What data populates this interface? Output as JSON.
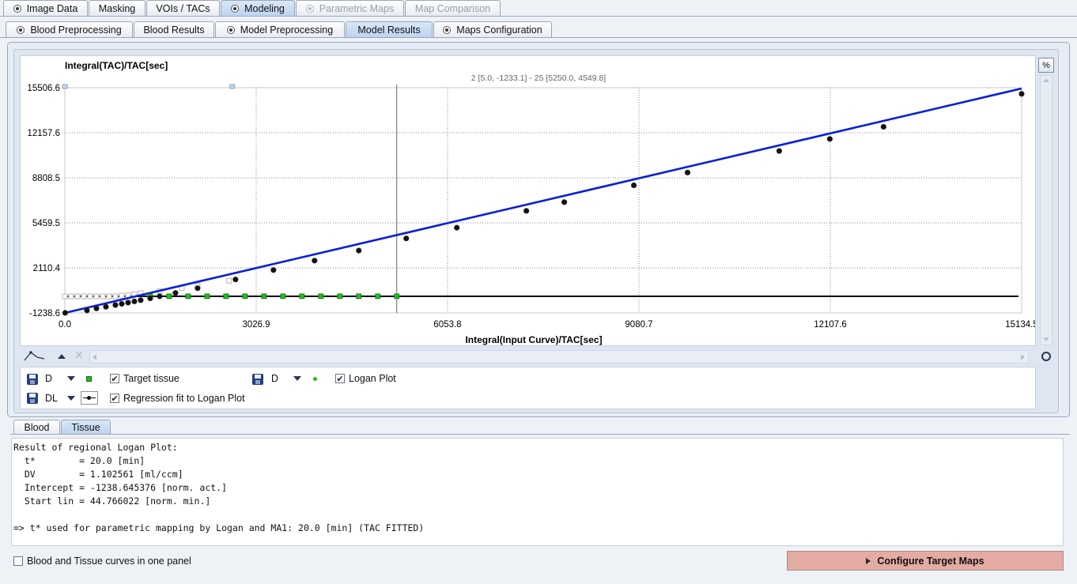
{
  "tabs_top": [
    {
      "label": "Image Data",
      "radio": true,
      "state": "normal"
    },
    {
      "label": "Masking",
      "radio": false,
      "state": "normal"
    },
    {
      "label": "VOIs / TACs",
      "radio": false,
      "state": "normal"
    },
    {
      "label": "Modeling",
      "radio": true,
      "state": "selected"
    },
    {
      "label": "Parametric Maps",
      "radio": true,
      "state": "disabled"
    },
    {
      "label": "Map Comparison",
      "radio": false,
      "state": "disabled"
    }
  ],
  "tabs_sub": [
    {
      "label": "Blood Preprocessing",
      "radio": true,
      "state": "normal"
    },
    {
      "label": "Blood Results",
      "radio": false,
      "state": "normal"
    },
    {
      "label": "Model Preprocessing",
      "radio": true,
      "state": "normal"
    },
    {
      "label": "Model Results",
      "radio": false,
      "state": "selected"
    },
    {
      "label": "Maps Configuration",
      "radio": true,
      "state": "normal"
    }
  ],
  "plot": {
    "ylabel": "Integral(TAC)/TAC[sec]",
    "xlabel": "Integral(Input Curve)/TAC[sec]",
    "range_info": "2 [5.0, -1233.1] - 25 [5250.0, 4549.8]",
    "percent_button": "%"
  },
  "chart_data": {
    "type": "scatter",
    "xlabel": "Integral(Input Curve)/TAC[sec]",
    "ylabel": "Integral(TAC)/TAC[sec]",
    "xlim": [
      0.0,
      15134.5
    ],
    "ylim": [
      -1238.6,
      15506.6
    ],
    "x_ticks": [
      "0.0",
      "3026.9",
      "6053.8",
      "9080.7",
      "12107.6",
      "15134.5"
    ],
    "y_ticks": [
      "-1238.6",
      "2110.4",
      "5459.5",
      "8808.5",
      "12157.6",
      "15506.6"
    ],
    "grid": true,
    "series": [
      {
        "name": "Target tissue",
        "color": "#22bb22",
        "marker": "square",
        "x": [
          1350,
          1650,
          1950,
          2250,
          2550,
          2850,
          3150,
          3450,
          3750,
          4050,
          4350,
          4650,
          4950,
          5250
        ],
        "y": [
          -1.0,
          0.5,
          1.5,
          2.0,
          2.5,
          2.8,
          3.0,
          3.2,
          3.3,
          3.4,
          3.5,
          3.6,
          3.6,
          3.7
        ]
      },
      {
        "name": "Logan Plot",
        "color": "#111111",
        "marker": "circle",
        "x": [
          5,
          350,
          500,
          650,
          800,
          900,
          1000,
          1100,
          1200,
          1350,
          1500,
          1750,
          2100,
          2700,
          3300,
          3950,
          4650,
          5400,
          6200,
          7300,
          7900,
          9000,
          9850,
          11300,
          12100,
          12950,
          15134
        ],
        "y": [
          -1233.1,
          -1050,
          -900,
          -780,
          -650,
          -560,
          -470,
          -380,
          -290,
          -150,
          0,
          250,
          600,
          1250,
          1950,
          2650,
          3400,
          4300,
          5100,
          6350,
          7000,
          8250,
          9200,
          10800,
          11700,
          12600,
          15050
        ]
      },
      {
        "name": "Regression fit to Logan Plot",
        "color": "#0a1fd6",
        "marker": "line",
        "x": [
          0,
          15134.5
        ],
        "y": [
          -1238.6,
          15450
        ]
      },
      {
        "name": "Excluded points",
        "color": "#b5b5b5",
        "marker": "hollow-square",
        "x": [
          0,
          100,
          200,
          300,
          400,
          500,
          600,
          700,
          800,
          900,
          1000,
          1100,
          1200,
          1500,
          1850,
          2100,
          2600
        ],
        "y": [
          -5,
          -5,
          -5,
          -5,
          -5,
          -5,
          -5,
          -5,
          -10,
          40,
          80,
          150,
          230,
          400,
          600,
          800,
          1150
        ]
      },
      {
        "name": "Baseline",
        "color": "#111111",
        "marker": "line",
        "x": [
          0,
          15134.5
        ],
        "y": [
          0,
          0
        ]
      }
    ]
  },
  "legend": [
    {
      "selector": "D",
      "label": "Target tissue",
      "marker": "green-square",
      "checked": true
    },
    {
      "selector": "D",
      "label": "Logan Plot",
      "marker": "green-dot",
      "checked": true
    },
    {
      "selector": "DL",
      "label": "Regression fit to Logan Plot",
      "marker": "line-dot",
      "checked": true
    }
  ],
  "check_mark": "✔",
  "bottom_tabs": [
    {
      "label": "Blood",
      "state": "normal"
    },
    {
      "label": "Tissue",
      "state": "selected"
    }
  ],
  "results": {
    "title": "Result of regional Logan Plot:",
    "lines": [
      "  t*        = 20.0 [min]",
      "  DV        = 1.102561 [ml/ccm]",
      "  Intercept = -1238.645376 [norm. act.]",
      "  Start lin = 44.766022 [norm. min.]"
    ],
    "summary": "=> t* used for parametric mapping by Logan and MA1: 20.0 [min] (TAC FITTED)"
  },
  "footer": {
    "one_panel_label": "Blood and Tissue curves in one panel",
    "one_panel_checked": false,
    "configure_button": "Configure Target Maps"
  },
  "colors": {
    "accent_button": "#e3aba2",
    "tab_selected": "#c7dbf3",
    "regression_line": "#0a1fd6"
  }
}
